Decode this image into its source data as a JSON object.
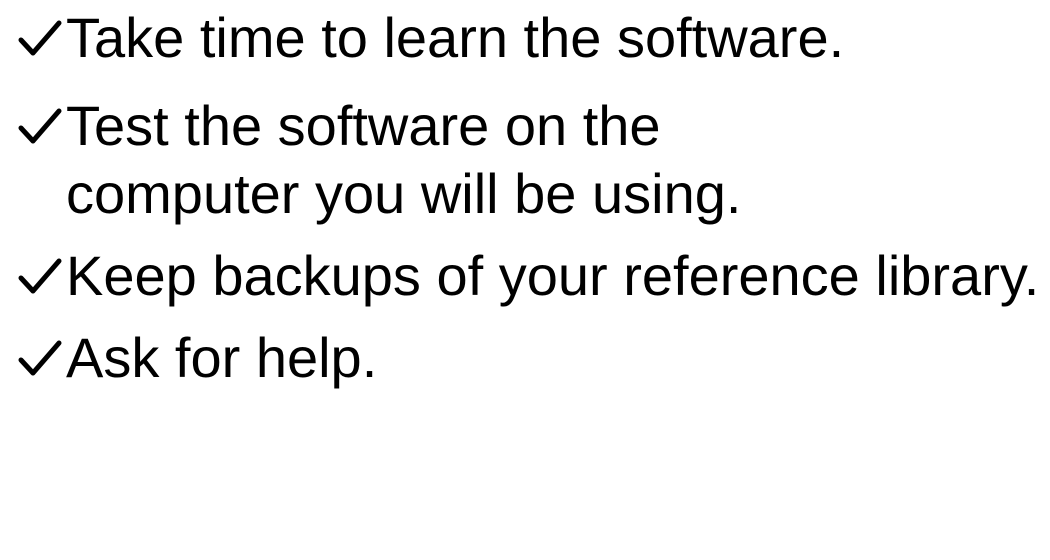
{
  "checklist": {
    "icon": "checkmark-icon",
    "items": [
      {
        "text": "Take time to learn the software."
      },
      {
        "text": "Test the software on the computer you will be using."
      },
      {
        "text": "Keep backups of your reference library."
      },
      {
        "text": "Ask for help."
      }
    ]
  },
  "colors": {
    "text": "#000000",
    "background": "#ffffff"
  }
}
